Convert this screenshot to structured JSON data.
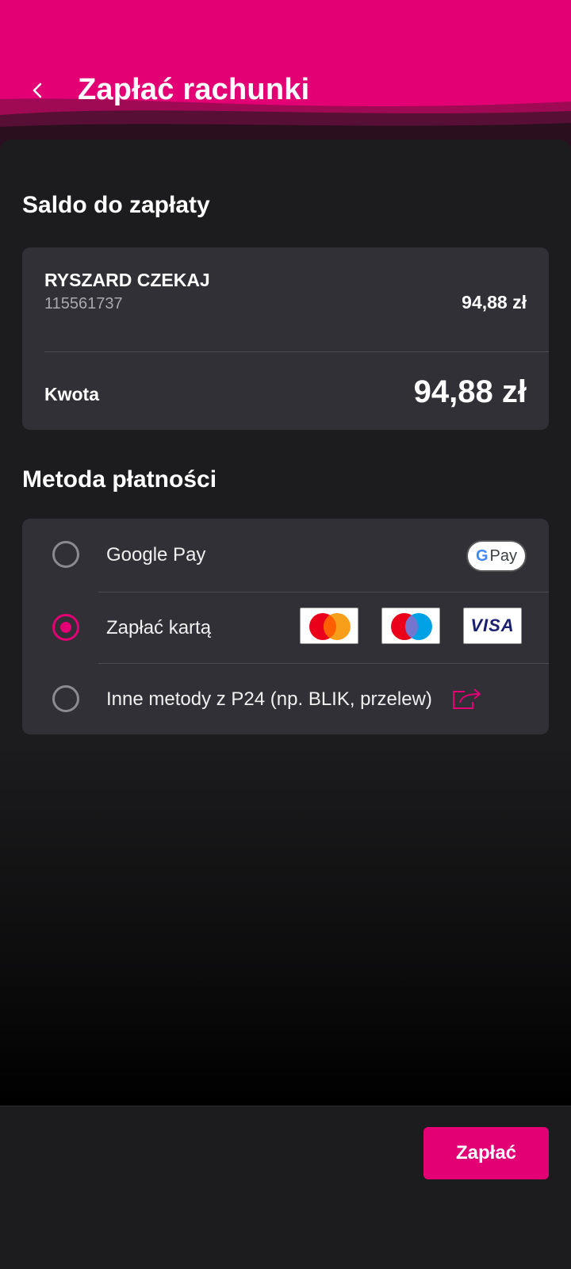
{
  "header": {
    "title": "Zapłać rachunki",
    "back_icon": "chevron-left-icon",
    "brand_color": "#e20074"
  },
  "balance": {
    "section_title": "Saldo do zapłaty",
    "account_name": "RYSZARD CZEKAJ",
    "account_number": "115561737",
    "account_amount": "94,88 zł",
    "amount_label": "Kwota",
    "amount_value": "94,88 zł"
  },
  "payment": {
    "section_title": "Metoda płatności",
    "methods": [
      {
        "label": "Google Pay",
        "selected": false,
        "logos": [
          "google-pay"
        ]
      },
      {
        "label": "Zapłać kartą",
        "selected": true,
        "logos": [
          "mastercard",
          "maestro",
          "visa"
        ]
      },
      {
        "label": "Inne metody z P24 (np. BLIK, przelew)",
        "selected": false,
        "logos": [
          "external-link-icon"
        ]
      }
    ],
    "gpay_text": "Pay",
    "gpay_g": "G",
    "visa_text": "VISA"
  },
  "footer": {
    "pay_label": "Zapłać"
  }
}
